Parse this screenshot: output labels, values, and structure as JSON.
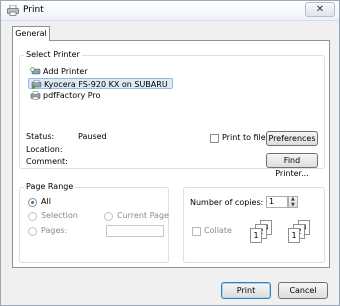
{
  "window": {
    "title": "Print",
    "close_symbol": "✕"
  },
  "tabs": [
    {
      "label": "General"
    }
  ],
  "select_printer": {
    "group_label": "Select Printer",
    "printers": [
      {
        "name": "Add Printer",
        "icon": "add-printer-icon"
      },
      {
        "name": "Kyocera FS-920 KX on SUBARU",
        "icon": "network-printer-icon",
        "selected": true
      },
      {
        "name": "pdfFactory Pro",
        "icon": "printer-icon"
      }
    ],
    "status_label": "Status:",
    "status_value": "Paused",
    "location_label": "Location:",
    "location_value": "",
    "comment_label": "Comment:",
    "comment_value": "",
    "print_to_file_label": "Print to file",
    "preferences_label": "Preferences",
    "find_printer_label": "Find Printer..."
  },
  "page_range": {
    "group_label": "Page Range",
    "all_label": "All",
    "selection_label": "Selection",
    "current_page_label": "Current Page",
    "pages_label": "Pages:",
    "pages_value": ""
  },
  "copies": {
    "number_label": "Number of copies:",
    "number_value": "1",
    "collate_label": "Collate",
    "collate_pages": [
      "1",
      "2",
      "3"
    ]
  },
  "footer": {
    "print_label": "Print",
    "cancel_label": "Cancel"
  },
  "colors": {
    "selection_bg": "#dfe9f6",
    "selection_border": "#95b8e7",
    "accent": "#2a72c4"
  }
}
